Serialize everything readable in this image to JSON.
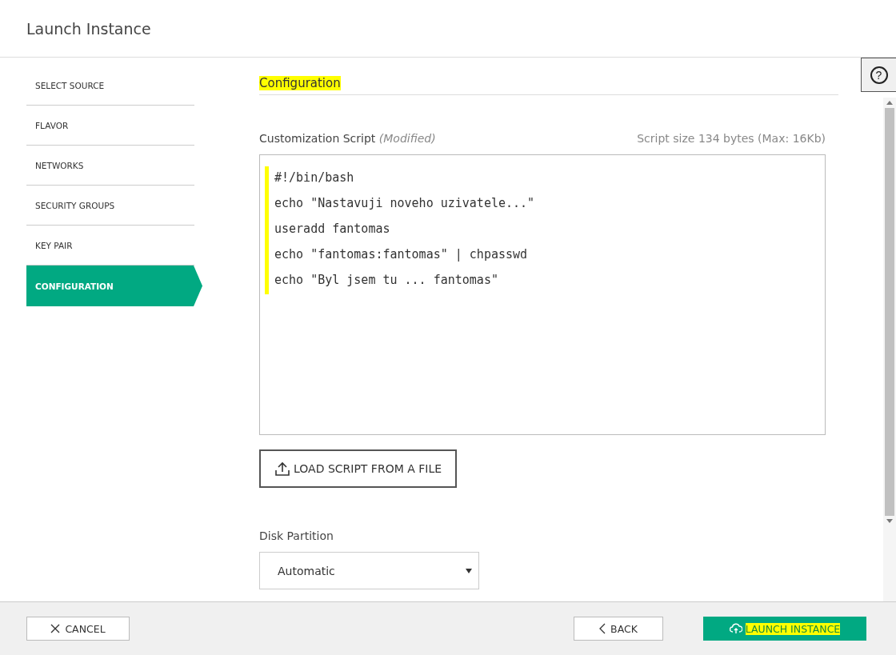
{
  "window": {
    "title": "Launch Instance"
  },
  "help_button": {
    "label": "?"
  },
  "steps": [
    {
      "label": "SELECT SOURCE",
      "selected": false
    },
    {
      "label": "FLAVOR",
      "selected": false
    },
    {
      "label": "NETWORKS",
      "selected": false
    },
    {
      "label": "SECURITY GROUPS",
      "selected": false
    },
    {
      "label": "KEY PAIR",
      "selected": false
    },
    {
      "label": "CONFIGURATION",
      "selected": true
    }
  ],
  "section": {
    "title": "Configuration",
    "highlighted": true
  },
  "script": {
    "label": "Customization Script",
    "note": "(Modified)",
    "size": "Script size 134 bytes (Max: 16Kb)",
    "highlighted": true,
    "lines": [
      "#!/bin/bash",
      "echo \"Nastavuji noveho uzivatele...\"",
      "useradd fantomas",
      "echo \"fantomas:fantomas\" | chpasswd",
      "echo \"Byl jsem tu ... fantomas\""
    ]
  },
  "load_button": {
    "label": "LOAD SCRIPT FROM A FILE"
  },
  "disk_partition": {
    "label": "Disk Partition",
    "value": "Automatic"
  },
  "footer": {
    "cancel": "CANCEL",
    "back": "BACK",
    "launch": {
      "label": "LAUNCH INSTANCE",
      "highlighted": true
    }
  }
}
